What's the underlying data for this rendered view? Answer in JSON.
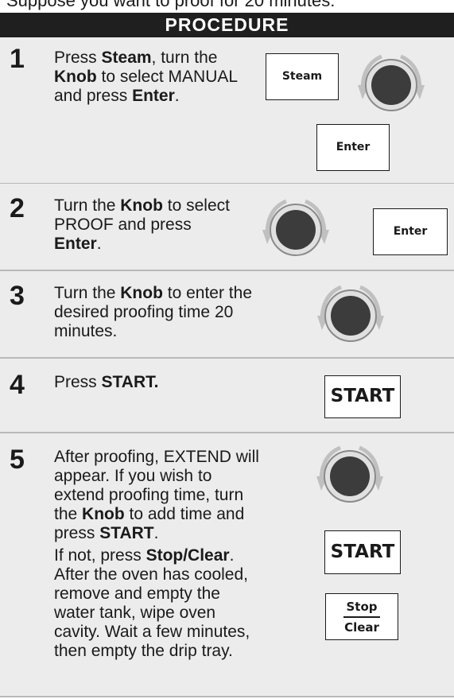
{
  "intro": "Suppose you want to proof for 20 minutes:",
  "header": "PROCEDURE",
  "steps": [
    {
      "number": "1",
      "t1": "Press ",
      "b1": "Steam",
      "t2": ", turn the",
      "b2": "Knob",
      "t3": " to select MANUAL",
      "t4": "and press ",
      "b3": "Enter",
      "t5": ".",
      "btn_steam": "Steam",
      "btn_enter": "Enter"
    },
    {
      "number": "2",
      "t1": "Turn the ",
      "b1": "Knob",
      "t2": " to select",
      "t3": "PROOF and press",
      "b2": "Enter",
      "t4": ".",
      "btn_enter": "Enter"
    },
    {
      "number": "3",
      "t1": "Turn the ",
      "b1": "Knob",
      "t2": " to enter the",
      "t3": "desired proofing time 20",
      "t4": "minutes."
    },
    {
      "number": "4",
      "t1": "Press ",
      "b1": "START.",
      "btn_start": "START"
    },
    {
      "number": "5",
      "l1": "After proofing, EXTEND will",
      "l2": "appear. If you wish to",
      "l3": "extend proofing time, turn",
      "l4a": "the ",
      "l4b": "Knob",
      "l4c": " to add time and",
      "l5a": "press ",
      "l5b": "START",
      "l5c": ".",
      "l6a": "If not, press ",
      "l6b": "Stop/Clear",
      "l6c": ".",
      "l7": "After the oven has cooled,",
      "l8": "remove and empty the",
      "l9": "water tank, wipe oven",
      "l10": "cavity. Wait a few minutes,",
      "l11": "then empty the drip tray.",
      "btn_start": "START",
      "btn_stop": "Stop",
      "btn_clear": "Clear"
    }
  ],
  "icons": {
    "knob": "rotary-knob-icon",
    "arrow_left": "rotate-left-arrow-icon",
    "arrow_right": "rotate-right-arrow-icon"
  },
  "colors": {
    "banner": "#1f1f1f",
    "panel": "#ececec",
    "divider": "#b9b9b9"
  }
}
